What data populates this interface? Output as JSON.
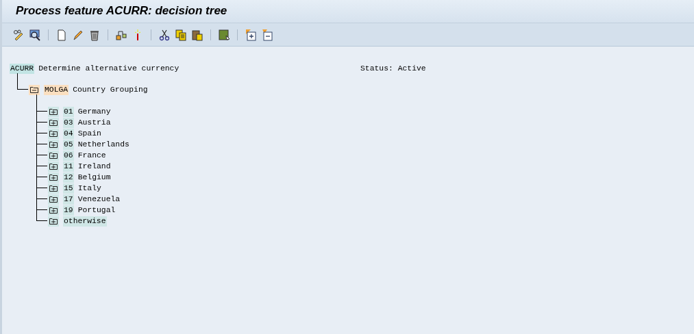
{
  "window": {
    "title": "Process feature ACURR: decision tree"
  },
  "tree": {
    "key": "ACURR",
    "text": "Determine alternative currency",
    "kind": "feature",
    "children": [
      {
        "key": "MOLGA",
        "text": "Country Grouping",
        "kind": "field",
        "expanded": true,
        "children": [
          {
            "key": "01",
            "text": "Germany",
            "kind": "value",
            "expanded": false
          },
          {
            "key": "03",
            "text": "Austria",
            "kind": "value",
            "expanded": false
          },
          {
            "key": "04",
            "text": "Spain",
            "kind": "value",
            "expanded": false
          },
          {
            "key": "05",
            "text": "Netherlands",
            "kind": "value",
            "expanded": false
          },
          {
            "key": "06",
            "text": "France",
            "kind": "value",
            "expanded": false
          },
          {
            "key": "11",
            "text": "Ireland",
            "kind": "value",
            "expanded": false
          },
          {
            "key": "12",
            "text": "Belgium",
            "kind": "value",
            "expanded": false
          },
          {
            "key": "15",
            "text": "Italy",
            "kind": "value",
            "expanded": false
          },
          {
            "key": "17",
            "text": "Venezuela",
            "kind": "value",
            "expanded": false
          },
          {
            "key": "19",
            "text": "Portugal",
            "kind": "value",
            "expanded": false
          },
          {
            "key": "otherwise",
            "kind": "value",
            "expanded": false
          }
        ]
      }
    ]
  },
  "status": "Status: Active"
}
